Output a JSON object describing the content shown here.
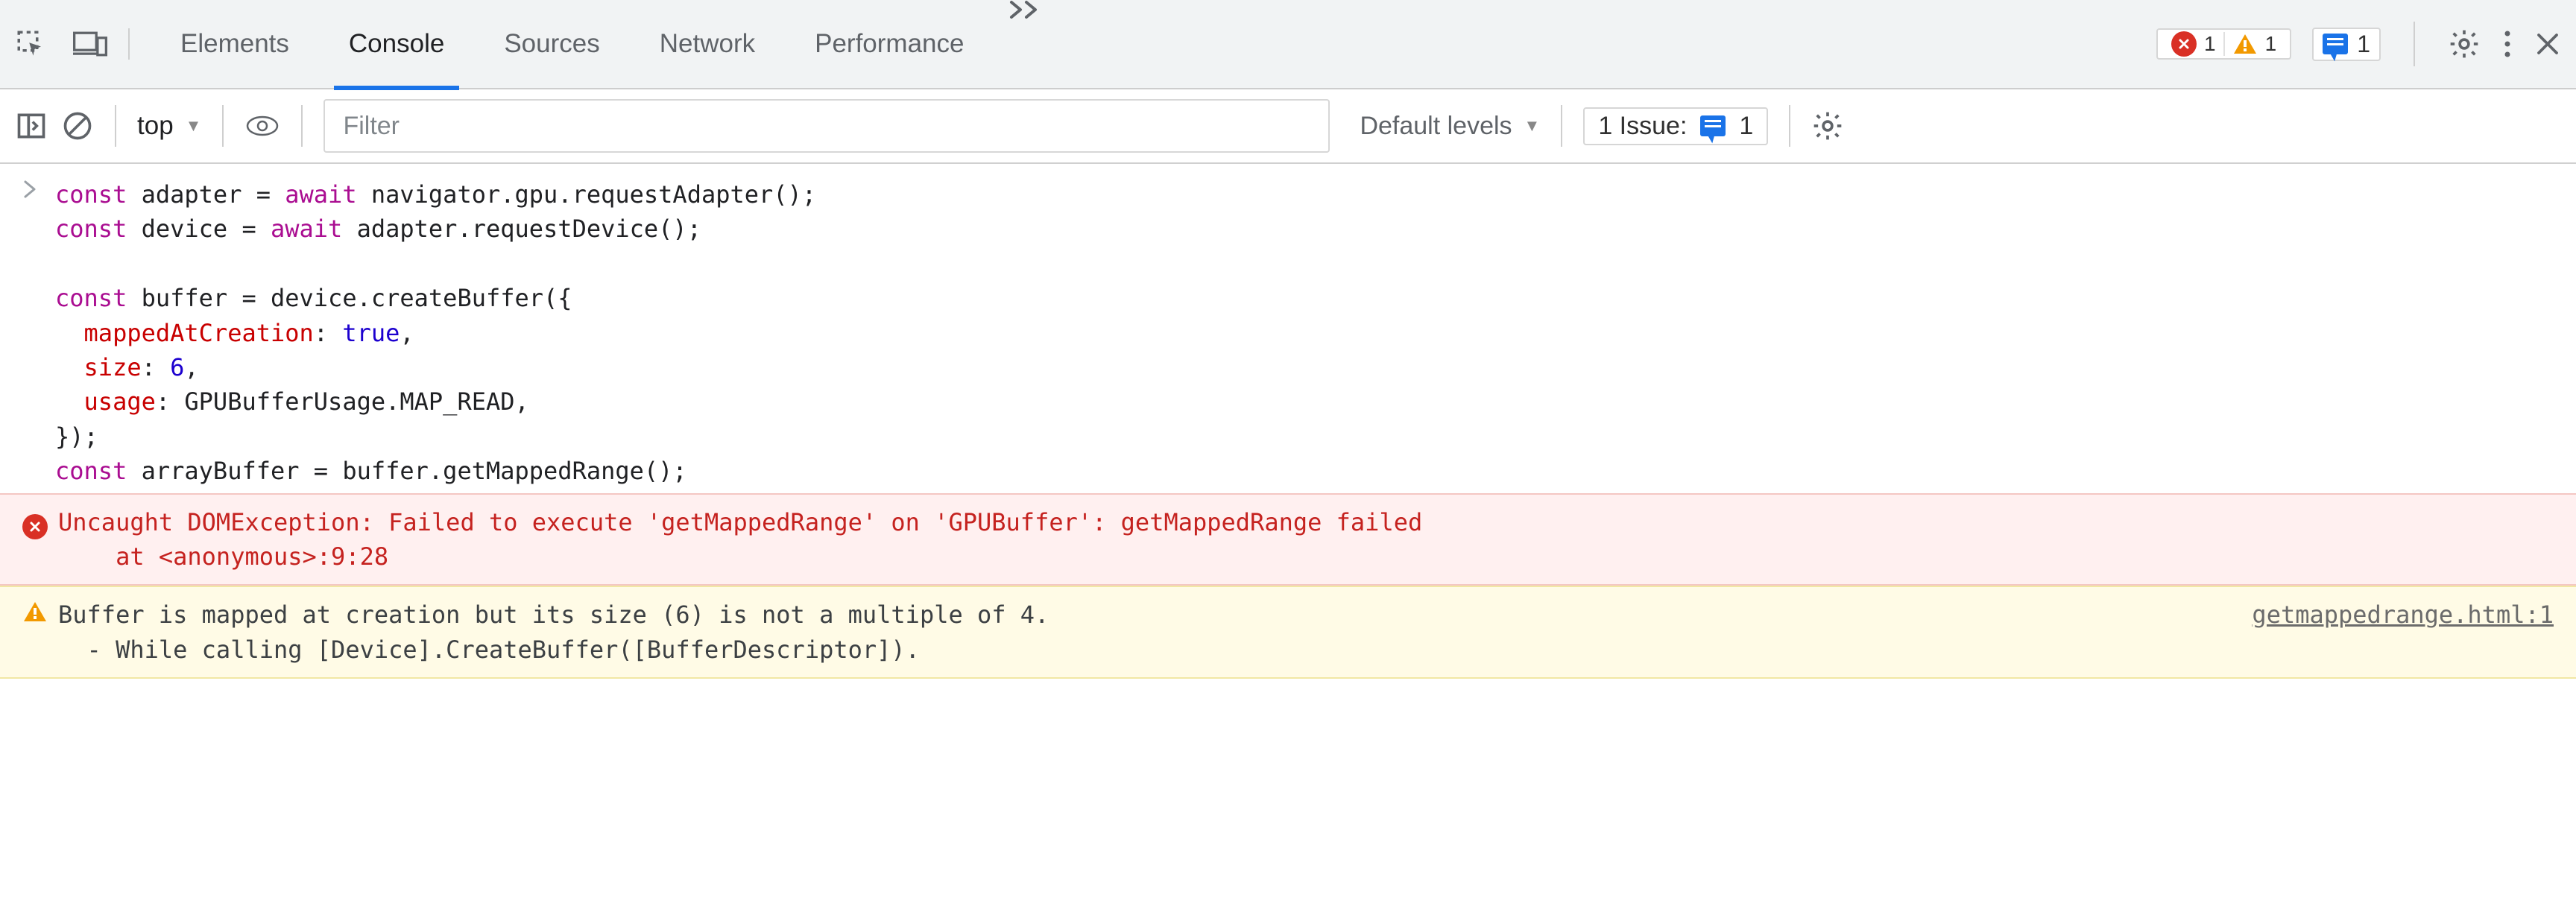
{
  "tabs": {
    "items": [
      "Elements",
      "Console",
      "Sources",
      "Network",
      "Performance"
    ],
    "active_index": 1
  },
  "badges": {
    "error_count": "1",
    "warning_count": "1",
    "info_count": "1"
  },
  "toolbar": {
    "context": "top",
    "filter_placeholder": "Filter",
    "levels_label": "Default levels",
    "issues_label": "1 Issue:",
    "issues_count": "1"
  },
  "console_input": {
    "code": "const adapter = await navigator.gpu.requestAdapter();\nconst device = await adapter.requestDevice();\n\nconst buffer = device.createBuffer({\n  mappedAtCreation: true,\n  size: 6,\n  usage: GPUBufferUsage.MAP_READ,\n});\nconst arrayBuffer = buffer.getMappedRange();"
  },
  "messages": {
    "error_line1": "Uncaught DOMException: Failed to execute 'getMappedRange' on 'GPUBuffer': getMappedRange failed",
    "error_line2": "    at <anonymous>:9:28",
    "warn_line1": "Buffer is mapped at creation but its size (6) is not a multiple of 4.",
    "warn_line2": "  - While calling [Device].CreateBuffer([BufferDescriptor]).",
    "warn_source": "getmappedrange.html:1"
  }
}
